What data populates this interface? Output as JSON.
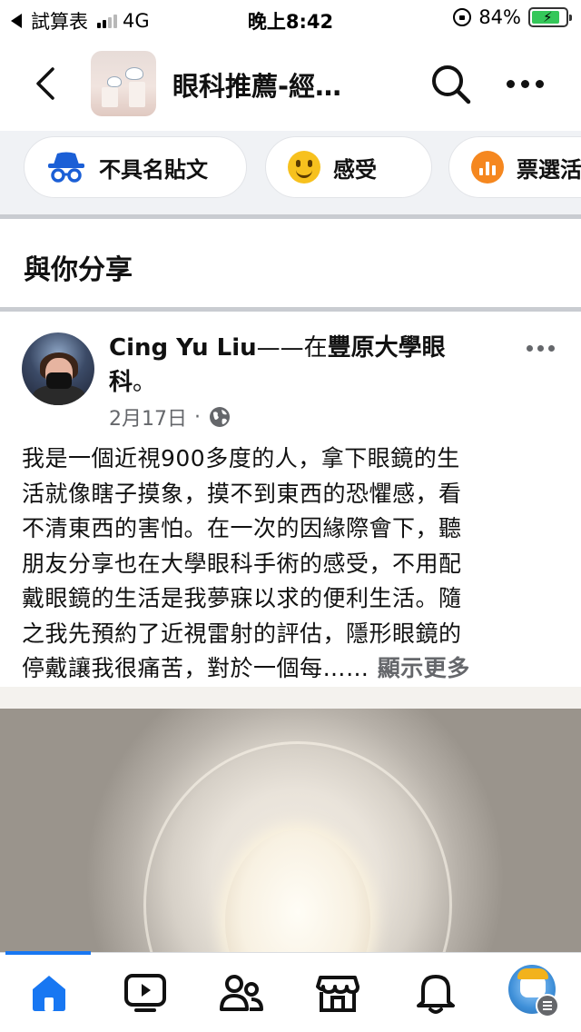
{
  "status_bar": {
    "back_app": "試算表",
    "network": "4G",
    "time": "晚上8:42",
    "battery_percent": "84%",
    "battery_level": 0.84,
    "signal_bars_active": 2
  },
  "header": {
    "title": "眼科推薦-經…",
    "back_icon": "chevron-left-icon",
    "search_icon": "search-icon",
    "more_icon": "more-horizontal-icon"
  },
  "composer_chips": [
    {
      "label": "不具名貼文",
      "icon": "anonymous-incognito-icon"
    },
    {
      "label": "感受",
      "icon": "smile-emoji-icon"
    },
    {
      "label": "票選活",
      "icon": "poll-icon"
    }
  ],
  "section": {
    "title": "與你分享"
  },
  "post": {
    "author": "Cing Yu Liu",
    "connector": "——在",
    "place": "豐原大學眼",
    "place_line2": "科",
    "place_suffix": "。",
    "date": "2月17日",
    "meta_separator": "·",
    "privacy_icon": "globe-icon",
    "body_lines": [
      "我是一個近視900多度的人，拿下眼鏡的生",
      "活就像瞎子摸象，摸不到東西的恐懼感，看",
      "不清東西的害怕。在一次的因緣際會下，聽",
      "朋友分享也在大學眼科手術的感受，不用配",
      "戴眼鏡的生活是我夢寐以求的便利生活。隨",
      "之我先預約了近視雷射的評估，隱形眼鏡的"
    ],
    "body_last_line": "停戴讓我很痛苦，對於一個每……",
    "see_more": "顯示更多"
  },
  "bottom_nav": {
    "items": [
      {
        "icon": "home-icon",
        "active": true
      },
      {
        "icon": "video-icon",
        "active": false
      },
      {
        "icon": "friends-icon",
        "active": false
      },
      {
        "icon": "marketplace-icon",
        "active": false
      },
      {
        "icon": "notifications-bell-icon",
        "active": false
      },
      {
        "icon": "profile-menu-icon",
        "active": false
      }
    ]
  },
  "colors": {
    "accent": "#1877f2",
    "secondary_text": "#65676b",
    "chip_band": "#f0f2f5"
  }
}
